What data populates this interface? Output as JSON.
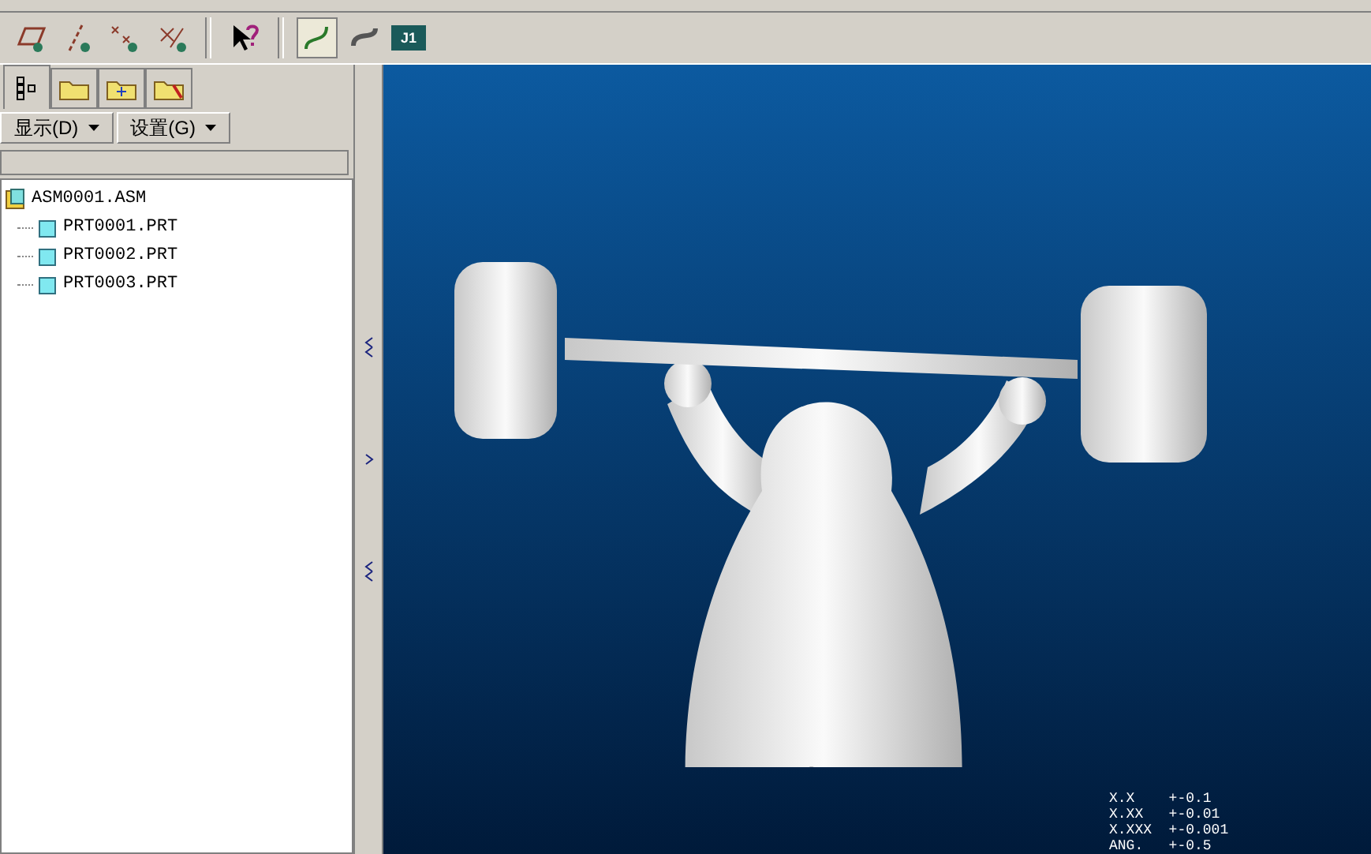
{
  "toolbar": {
    "tools": [
      {
        "kind": "plane"
      },
      {
        "kind": "axis"
      },
      {
        "kind": "point"
      },
      {
        "kind": "csys"
      },
      {
        "kind": "sep"
      },
      {
        "kind": "help"
      },
      {
        "kind": "sep"
      },
      {
        "kind": "curve",
        "selected": true
      },
      {
        "kind": "spline",
        "selected": false
      },
      {
        "kind": "tag",
        "label": "J1"
      }
    ]
  },
  "panel": {
    "tabs": [
      {
        "kind": "tree",
        "selected": true
      },
      {
        "kind": "folders",
        "selected": false
      },
      {
        "kind": "star-folder",
        "selected": false
      },
      {
        "kind": "folder-tools",
        "selected": false
      }
    ],
    "menus": [
      {
        "label": "显示(D)"
      },
      {
        "label": "设置(G)"
      }
    ],
    "tree": [
      {
        "label": "ASM0001.ASM",
        "kind": "assembly",
        "children": [
          {
            "label": "PRT0001.PRT",
            "kind": "part"
          },
          {
            "label": "PRT0002.PRT",
            "kind": "part"
          },
          {
            "label": "PRT0003.PRT",
            "kind": "part"
          }
        ]
      }
    ]
  },
  "viewport": {
    "tolerances": [
      "X.X    +-0.1",
      "X.XX   +-0.01",
      "X.XXX  +-0.001",
      "ANG.   +-0.5"
    ]
  }
}
